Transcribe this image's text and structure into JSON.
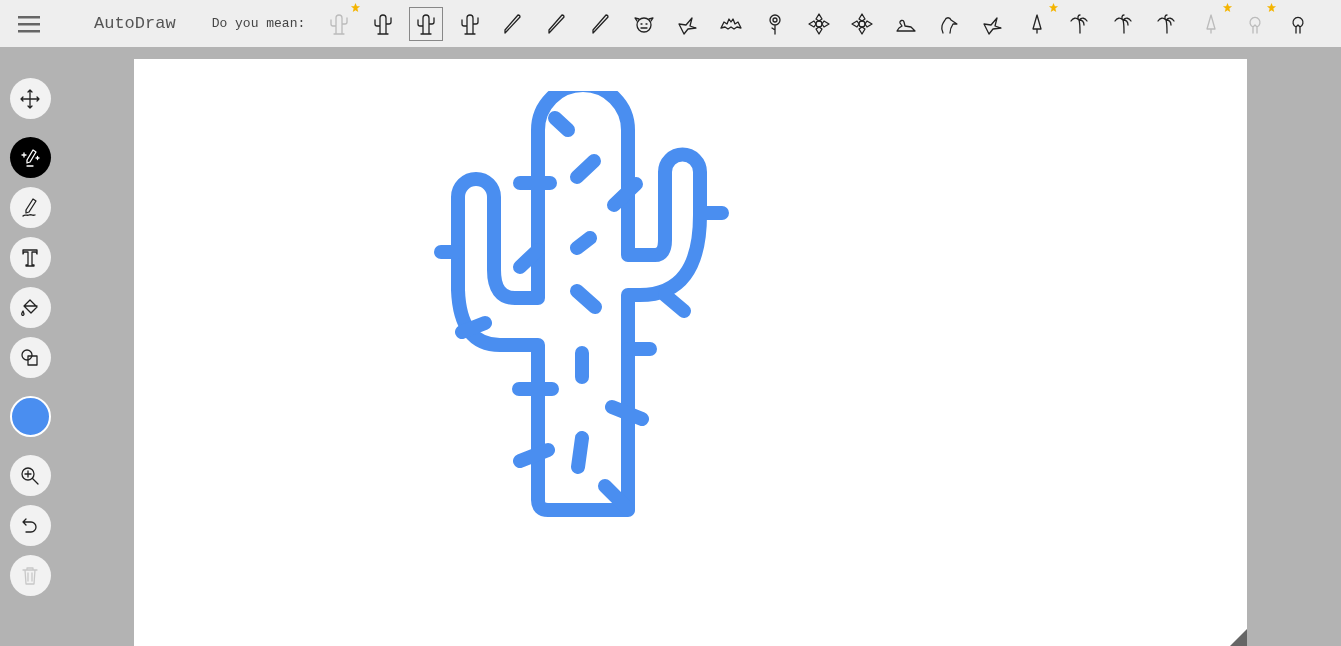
{
  "app_title": "AutoDraw",
  "suggestions": {
    "label": "Do you mean:",
    "items": [
      {
        "kind": "cactus",
        "starred": true,
        "faded": true,
        "selected": false
      },
      {
        "kind": "cactus",
        "starred": false,
        "faded": false,
        "selected": false
      },
      {
        "kind": "cactus",
        "starred": false,
        "faded": false,
        "selected": true
      },
      {
        "kind": "cactus",
        "starred": false,
        "faded": false,
        "selected": false
      },
      {
        "kind": "baseball-bat",
        "starred": false,
        "faded": false,
        "selected": false
      },
      {
        "kind": "baseball-bat",
        "starred": false,
        "faded": false,
        "selected": false
      },
      {
        "kind": "baseball-bat",
        "starred": false,
        "faded": false,
        "selected": false
      },
      {
        "kind": "face",
        "starred": false,
        "faded": false,
        "selected": false
      },
      {
        "kind": "bird",
        "starred": false,
        "faded": false,
        "selected": false
      },
      {
        "kind": "bat",
        "starred": false,
        "faded": false,
        "selected": false
      },
      {
        "kind": "flower",
        "starred": false,
        "faded": false,
        "selected": false
      },
      {
        "kind": "mandala",
        "starred": false,
        "faded": false,
        "selected": false
      },
      {
        "kind": "mandala",
        "starred": false,
        "faded": false,
        "selected": false
      },
      {
        "kind": "duck",
        "starred": false,
        "faded": false,
        "selected": false
      },
      {
        "kind": "goose",
        "starred": false,
        "faded": false,
        "selected": false
      },
      {
        "kind": "bird",
        "starred": false,
        "faded": false,
        "selected": false
      },
      {
        "kind": "pine",
        "starred": true,
        "faded": false,
        "selected": false
      },
      {
        "kind": "palm",
        "starred": false,
        "faded": false,
        "selected": false
      },
      {
        "kind": "palm",
        "starred": false,
        "faded": false,
        "selected": false
      },
      {
        "kind": "palm",
        "starred": false,
        "faded": false,
        "selected": false
      },
      {
        "kind": "pine",
        "starred": true,
        "faded": true,
        "selected": false
      },
      {
        "kind": "tree",
        "starred": true,
        "faded": true,
        "selected": false
      },
      {
        "kind": "tree",
        "starred": false,
        "faded": false,
        "selected": false
      }
    ]
  },
  "tool_groups": [
    {
      "tools": [
        {
          "kind": "move",
          "selected": false,
          "disabled": false
        }
      ]
    },
    {
      "tools": [
        {
          "kind": "autodraw",
          "selected": true,
          "disabled": false
        },
        {
          "kind": "draw",
          "selected": false,
          "disabled": false
        },
        {
          "kind": "type",
          "selected": false,
          "disabled": false
        },
        {
          "kind": "fill",
          "selected": false,
          "disabled": false
        },
        {
          "kind": "shape",
          "selected": false,
          "disabled": false
        }
      ]
    },
    {
      "tools": [
        {
          "kind": "color",
          "color": "#4a8ef0"
        }
      ]
    },
    {
      "tools": [
        {
          "kind": "zoom",
          "selected": false,
          "disabled": false
        },
        {
          "kind": "undo",
          "selected": false,
          "disabled": false
        },
        {
          "kind": "delete",
          "selected": false,
          "disabled": true
        }
      ]
    }
  ]
}
